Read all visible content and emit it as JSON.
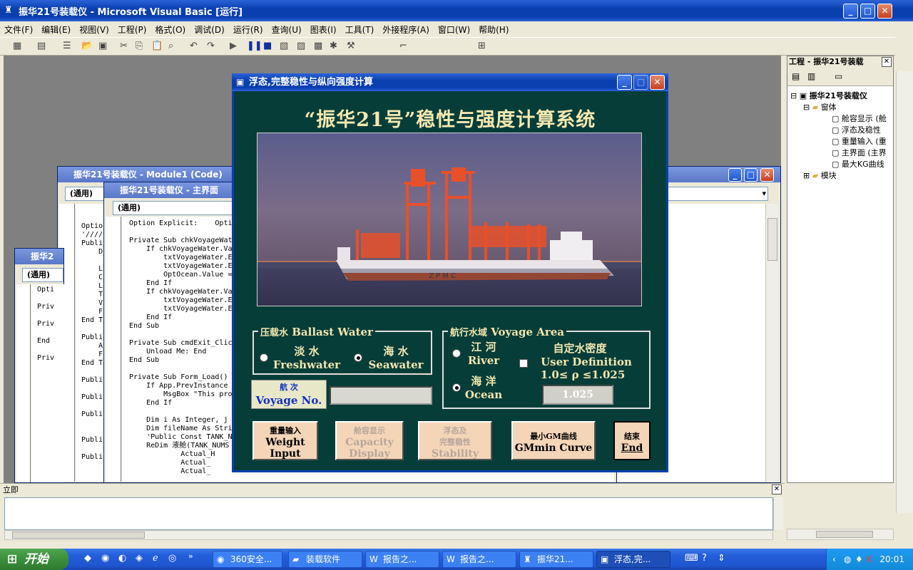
{
  "main_window": {
    "title": "振华21号装载仪 - Microsoft Visual Basic [运行]",
    "menu": [
      "文件(F)",
      "编辑(E)",
      "视图(V)",
      "工程(P)",
      "格式(O)",
      "调试(D)",
      "运行(R)",
      "查询(U)",
      "图表(I)",
      "工具(T)",
      "外接程序(A)",
      "窗口(W)",
      "帮助(H)"
    ]
  },
  "code_windows": {
    "module1_title": "振华21号装载仪 - Module1 (Code)",
    "main_form_title": "振华21号装载仪 - 主界面",
    "third_title": "振华2",
    "general_combo": "(通用)",
    "module1_lines": [
      "Optio",
      "'////",
      "Publi",
      "    D",
      "",
      "    L",
      "    C",
      "    L",
      "    T",
      "    V",
      "    F",
      "End T",
      "",
      "Publi",
      "    A",
      "    F",
      "End T",
      "",
      "Publi",
      "",
      "Publi",
      "",
      "Publi",
      "",
      "",
      "Publi",
      "",
      "Publi"
    ],
    "main_lines": [
      "Option Explicit:    Opti",
      "",
      "Private Sub chkVoyageWat",
      "    If chkVoyageWater.Va",
      "        txtVoyageWater.E",
      "        txtVoyageWater.E",
      "        OptOcean.Value =",
      "    End If",
      "    If chkVoyageWater.Va",
      "        txtVoyageWater.E",
      "        txtVoyageWater.E",
      "    End If",
      "End Sub",
      "",
      "Private Sub cmdExit_Clic",
      "    Unload Me: End",
      "End Sub",
      "",
      "Private Sub Form_Load()",
      "    If App.PrevInstance",
      "        MsgBox \"This pro",
      "    End If",
      "",
      "    Dim i As Integer, j",
      "    Dim fileName As Stri",
      "    'Public Const TANK_N",
      "    ReDim 液舱(TANK_NUMS",
      "            Actual_H",
      "            Actual_",
      "            Actual_"
    ],
    "third_lines": [
      "Opti",
      "",
      "Priv",
      "",
      "Priv",
      "",
      "End",
      "",
      "Priv"
    ]
  },
  "project_pane": {
    "title": "工程 - 振华21号装载",
    "root": "振华21号装载仪",
    "folder_forms": "窗体",
    "forms": [
      "舱容显示 (舱",
      "浮态及稳性",
      "重量输入 (重",
      "主界面 (主界",
      "最大KG曲线"
    ],
    "folder_modules": "模块"
  },
  "immediate": {
    "title": "立即"
  },
  "dialog": {
    "title": "浮态,完整稳性与纵向强度计算",
    "heading": "“振华21号”稳性与强度计算系统",
    "ballast": {
      "legend_cn": "压载水",
      "legend_en": "Ballast Water",
      "fresh_cn": "淡 水",
      "fresh_en": "Freshwater",
      "sea_cn": "海 水",
      "sea_en": "Seawater",
      "selected": "seawater"
    },
    "voyage": {
      "label_cn": "航 次",
      "label_en": "Voyage No.",
      "value": ""
    },
    "area": {
      "legend_cn": "航行水域",
      "legend_en": "Voyage Area",
      "river_cn": "江 河",
      "river_en": "River",
      "ocean_cn": "海 洋",
      "ocean_en": "Ocean",
      "selected": "ocean",
      "custom_cn": "自定水密度",
      "custom_en": "User Definition",
      "range": "1.0≤ ρ ≤1.025",
      "density_value": "1.025"
    },
    "buttons": {
      "weight_cn": "重量输入",
      "weight_en1": "Weight",
      "weight_en2": "Input",
      "capacity_cn": "舱容显示",
      "capacity_en1": "Capacity",
      "capacity_en2": "Display",
      "stability_cn1": "浮态及",
      "stability_cn2": "完整稳性",
      "stability_en": "Stability",
      "gm_cn": "最小GM曲线",
      "gm_en": "GMmin Curve",
      "end_cn": "结束",
      "end_en": "End"
    },
    "photo_text": "Z P M C"
  },
  "taskbar": {
    "start": "开始",
    "tasks": [
      "360安全...",
      "装载软件",
      "报告之...",
      "报告之...",
      "振华21...",
      "浮态,完..."
    ],
    "clock": "20:01"
  }
}
